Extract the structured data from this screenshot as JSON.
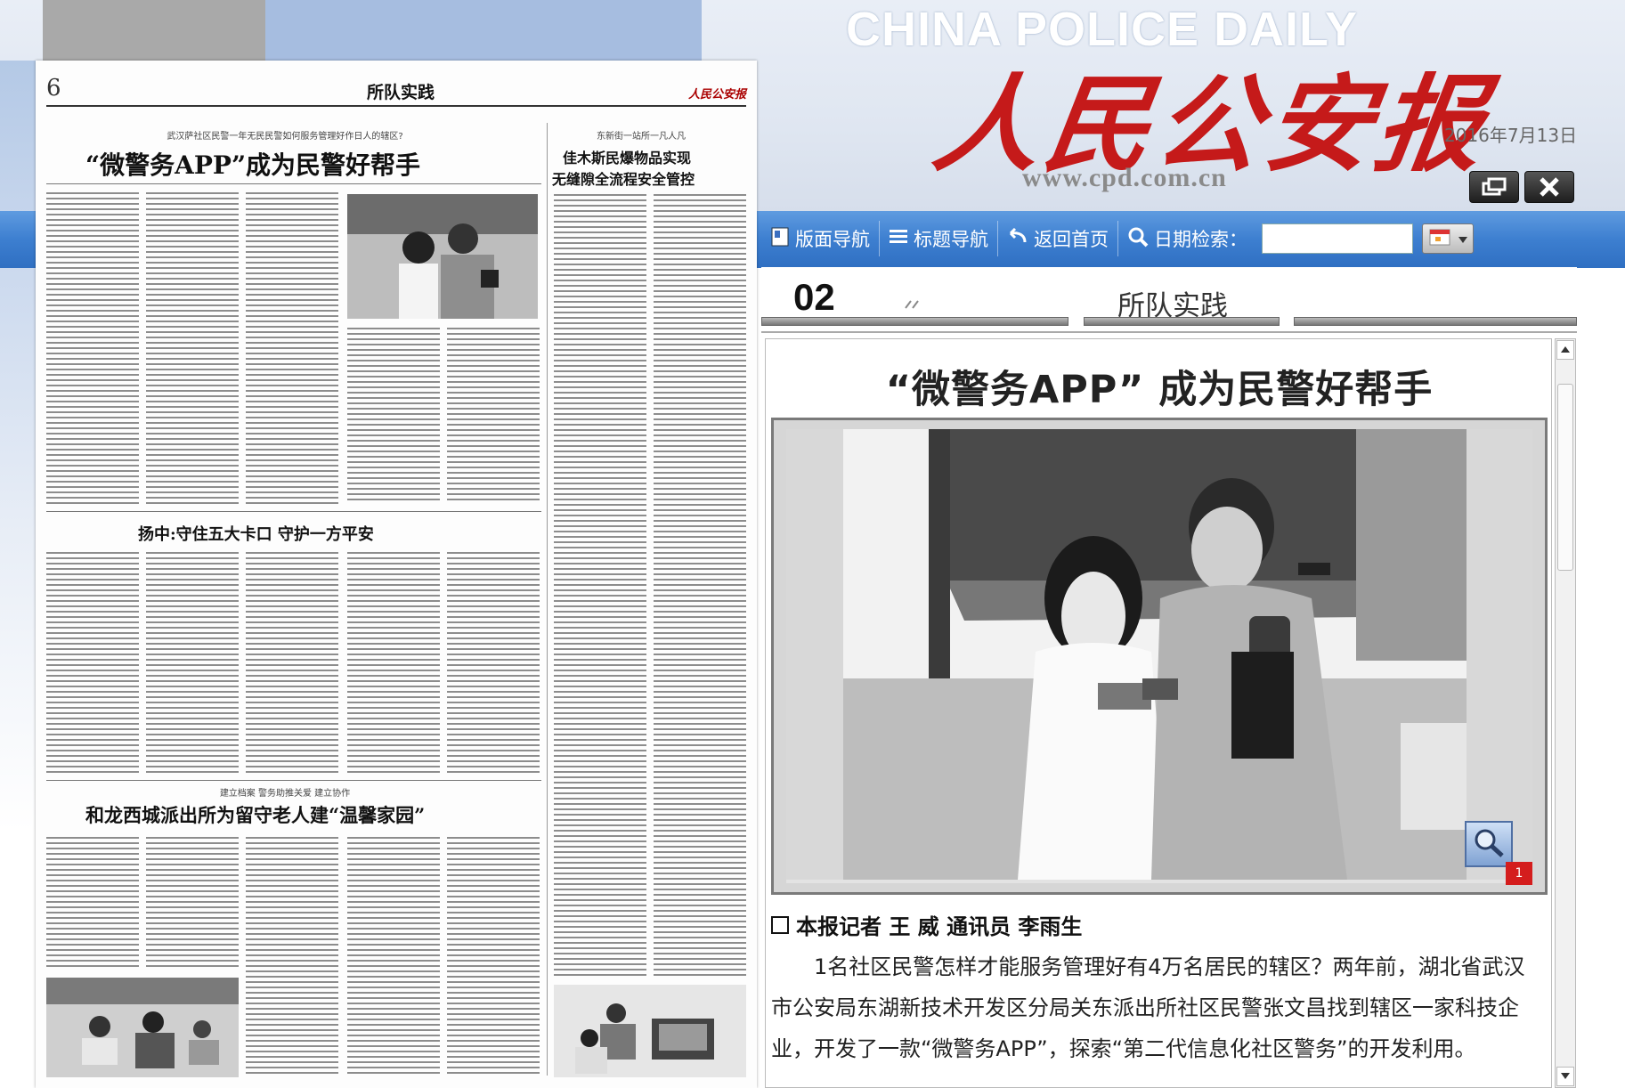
{
  "masthead": {
    "title_en": "CHINA POLICE DAILY",
    "title_cn": "人民公安报",
    "url": "www.cpd.com.cn",
    "date": "2016年7月13日"
  },
  "toolbar": {
    "items": [
      {
        "label": "版面导航",
        "icon": "layout-icon"
      },
      {
        "label": "标题导航",
        "icon": "list-icon"
      },
      {
        "label": "返回首页",
        "icon": "return-icon"
      },
      {
        "label": "日期检索：",
        "icon": "search-icon"
      }
    ],
    "date_input_value": "",
    "window_buttons": [
      "restore-icon",
      "close-icon"
    ]
  },
  "newspaper_page": {
    "page_number": "6",
    "section": "所队实践",
    "headline_1_kicker": "武汉萨社区民警一年无民民警如何服务管理好作日人的辖区?",
    "headline_1": "“微警务APP”成为民警好帮手",
    "headline_2_kicker": "东新街一站所一凡人凡",
    "headline_2_line1": "佳木斯民爆物品实现",
    "headline_2_line2": "无缝隙全流程安全管控",
    "headline_3": "扬中:守住五大卡口  守护一方平安",
    "headline_4_kicker": "建立档案  警务助推关爱  建立协作",
    "headline_4": "和龙西城派出所为留守老人建“温馨家园”"
  },
  "reader": {
    "page_number": "02",
    "section": "所队实践",
    "article_title": "“微警务APP” 成为民警好帮手",
    "byline": "本报记者  王 威  通讯员  李雨生",
    "body": "1名社区民警怎样才能服务管理好有4万名居民的辖区？两年前，湖北省武汉市公安局东湖新技术开发区分局关东派出所社区民警张文昌找到辖区一家科技企业，开发了一款“微警务APP”，探索“第二代信息化社区警务”的开发利用。",
    "red_tag": "1"
  }
}
